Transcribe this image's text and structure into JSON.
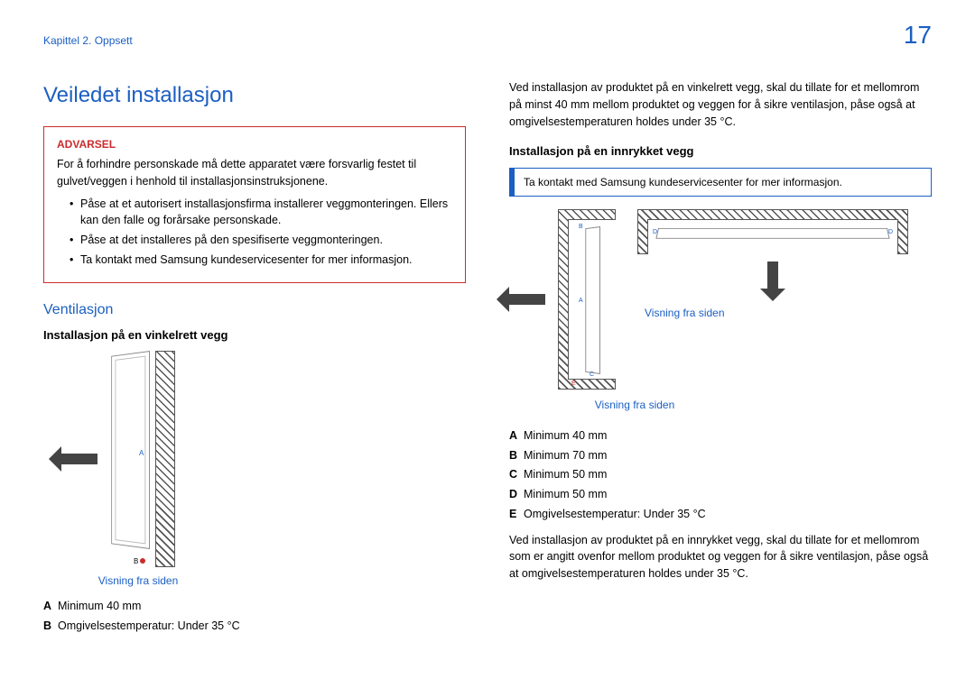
{
  "header": {
    "chapter": "Kapittel 2. Oppsett",
    "page_number": "17"
  },
  "left": {
    "title": "Veiledet installasjon",
    "warning": {
      "label": "Advarsel",
      "text": "For å forhindre personskade må dette apparatet være forsvarlig festet til gulvet/veggen i henhold til installasjonsinstruksjonene.",
      "bullets": [
        "Påse at et autorisert installasjonsfirma installerer veggmonteringen. Ellers kan den falle og forårsake personskade.",
        "Påse at det installeres på den spesifiserte veggmonteringen.",
        "Ta kontakt med Samsung kundeservicesenter for mer informasjon."
      ]
    },
    "ventilasjon": {
      "heading": "Ventilasjon",
      "sub": "Installasjon på en vinkelrett vegg",
      "caption": "Visning fra siden",
      "labels": {
        "a": "A",
        "b": "B"
      },
      "legend": {
        "a": {
          "k": "A",
          "v": "Minimum 40 mm"
        },
        "b": {
          "k": "B",
          "v": "Omgivelsestemperatur: Under 35 °C"
        }
      }
    }
  },
  "right": {
    "intro": "Ved installasjon av produktet på en vinkelrett vegg, skal du tillate for et mellomrom på minst 40 mm mellom produktet og veggen for å sikre ventilasjon, påse også at omgivelsestemperaturen holdes under 35 °C.",
    "sub": "Installasjon på en innrykket vegg",
    "info": "Ta kontakt med Samsung kundeservicesenter for mer informasjon.",
    "captions": {
      "side": "Visning fra siden",
      "side2": "Visning fra siden"
    },
    "labels": {
      "a": "A",
      "b": "B",
      "c": "C",
      "d": "D",
      "e": "E"
    },
    "legend": {
      "a": {
        "k": "A",
        "v": "Minimum 40 mm"
      },
      "b": {
        "k": "B",
        "v": "Minimum 70 mm"
      },
      "c": {
        "k": "C",
        "v": "Minimum 50 mm"
      },
      "d": {
        "k": "D",
        "v": "Minimum 50 mm"
      },
      "e": {
        "k": "E",
        "v": "Omgivelsestemperatur: Under 35 °C"
      }
    },
    "outro": "Ved installasjon av produktet på en innrykket vegg, skal du tillate for et mellomrom som er angitt ovenfor mellom produktet og veggen for å sikre ventilasjon, påse også at omgivelsestemperaturen holdes under 35 °C."
  }
}
